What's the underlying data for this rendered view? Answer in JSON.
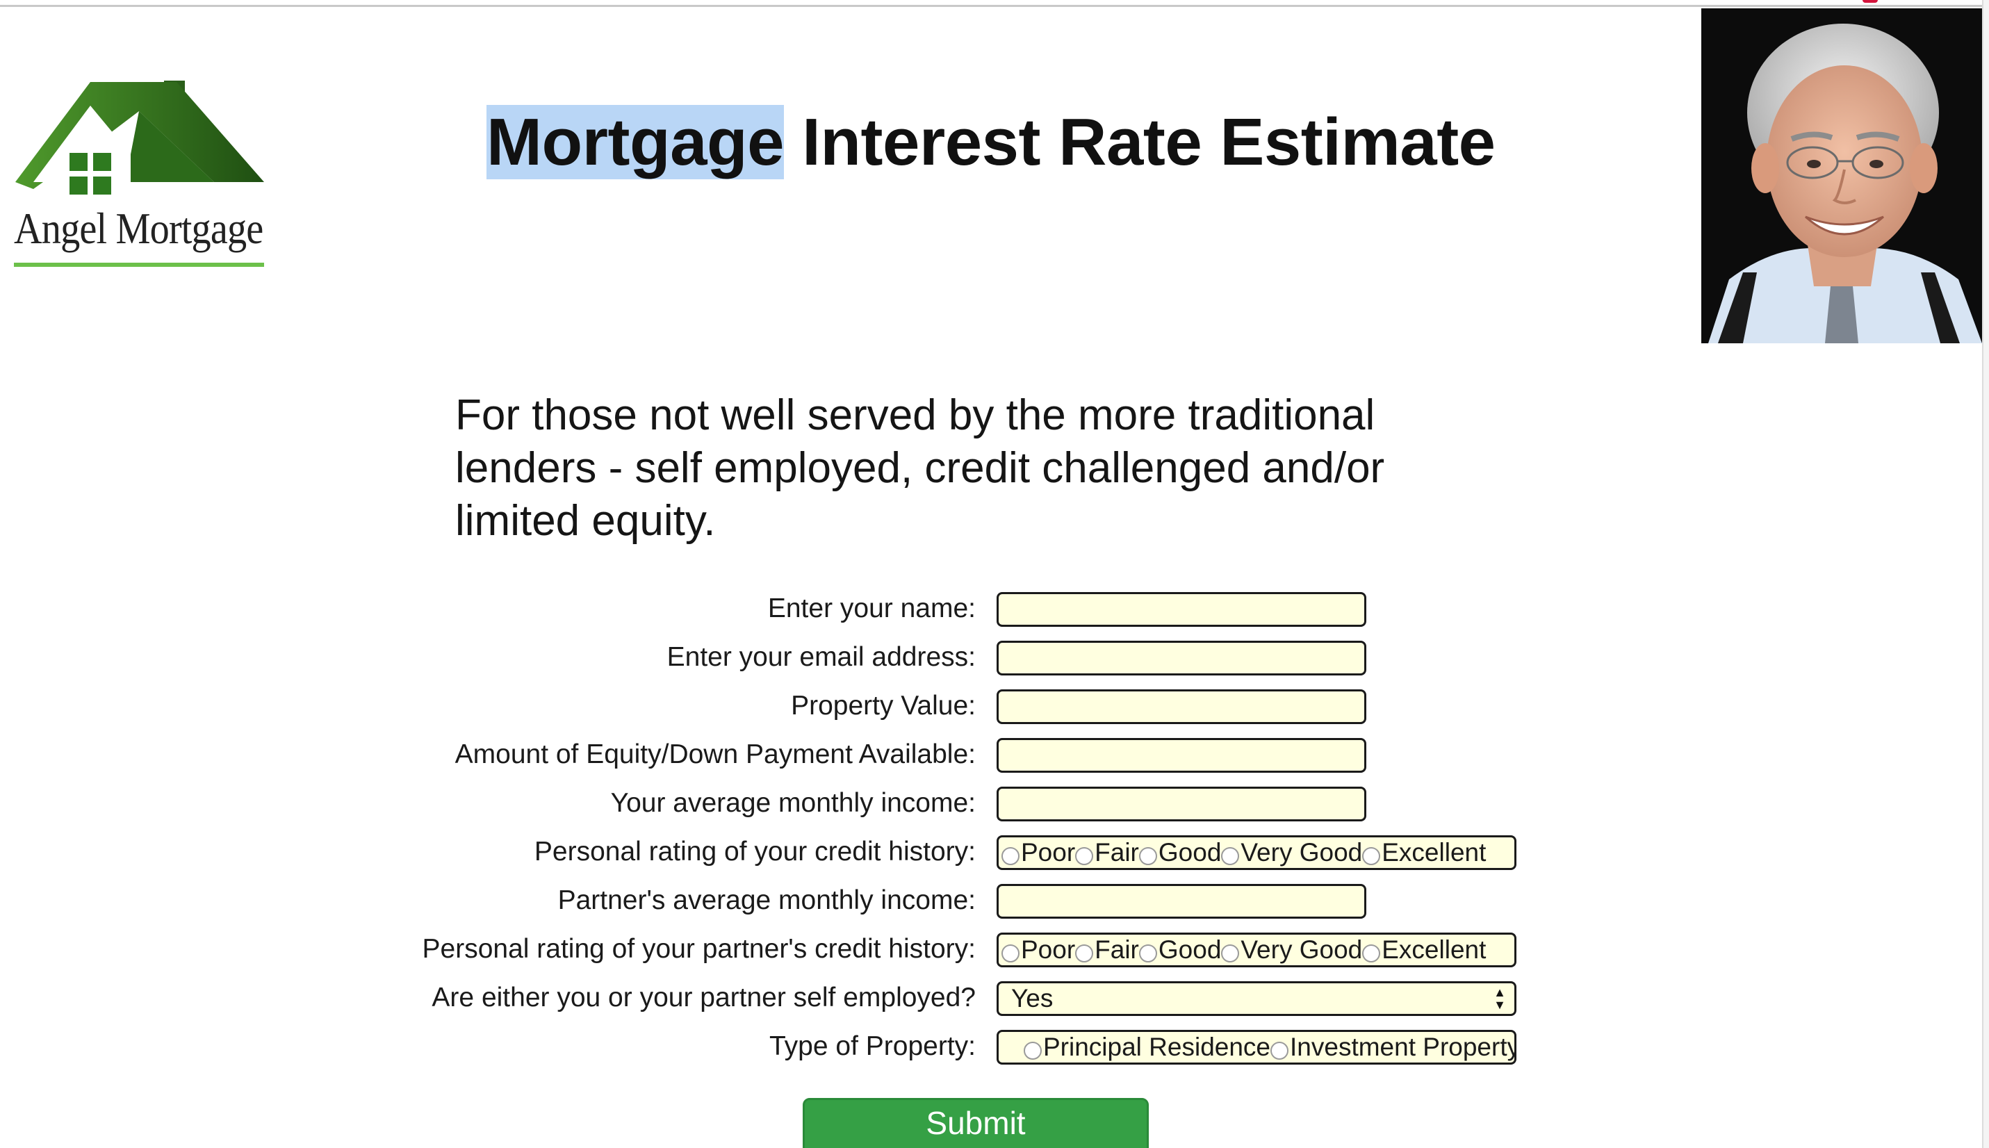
{
  "brand": {
    "logo_text": "Angel Mortgage",
    "primary_green": "#2f6e1f",
    "accent_green": "#6cc04a"
  },
  "header": {
    "title_highlighted": "Mortgage",
    "title_rest": " Interest Rate Estimate"
  },
  "tagline": "For those not well served by the more traditional lenders - self employed, credit challenged and/or limited equity.",
  "form": {
    "name_label": "Enter your name:",
    "name_value": "",
    "email_label": "Enter your email address:",
    "email_value": "",
    "property_value_label": "Property Value:",
    "property_value_value": "",
    "equity_label": "Amount of Equity/Down Payment Available:",
    "equity_value": "",
    "income_label": "Your average monthly income:",
    "income_value": "",
    "credit_label": "Personal rating of your credit history:",
    "credit_options": [
      "Poor",
      "Fair",
      "Good",
      "Very Good",
      "Excellent"
    ],
    "partner_income_label": "Partner's average monthly income:",
    "partner_income_value": "",
    "partner_credit_label": "Personal rating of your partner's credit history:",
    "partner_credit_options": [
      "Poor",
      "Fair",
      "Good",
      "Very Good",
      "Excellent"
    ],
    "self_employed_label": "Are either you or your partner self employed?",
    "self_employed_selected": "Yes",
    "property_type_label": "Type of Property:",
    "property_type_options": [
      "Principal Residence",
      "Investment Property"
    ],
    "input_bg": "#ffffe0"
  },
  "submit_label": "Submit",
  "submit_color": "#35a045"
}
